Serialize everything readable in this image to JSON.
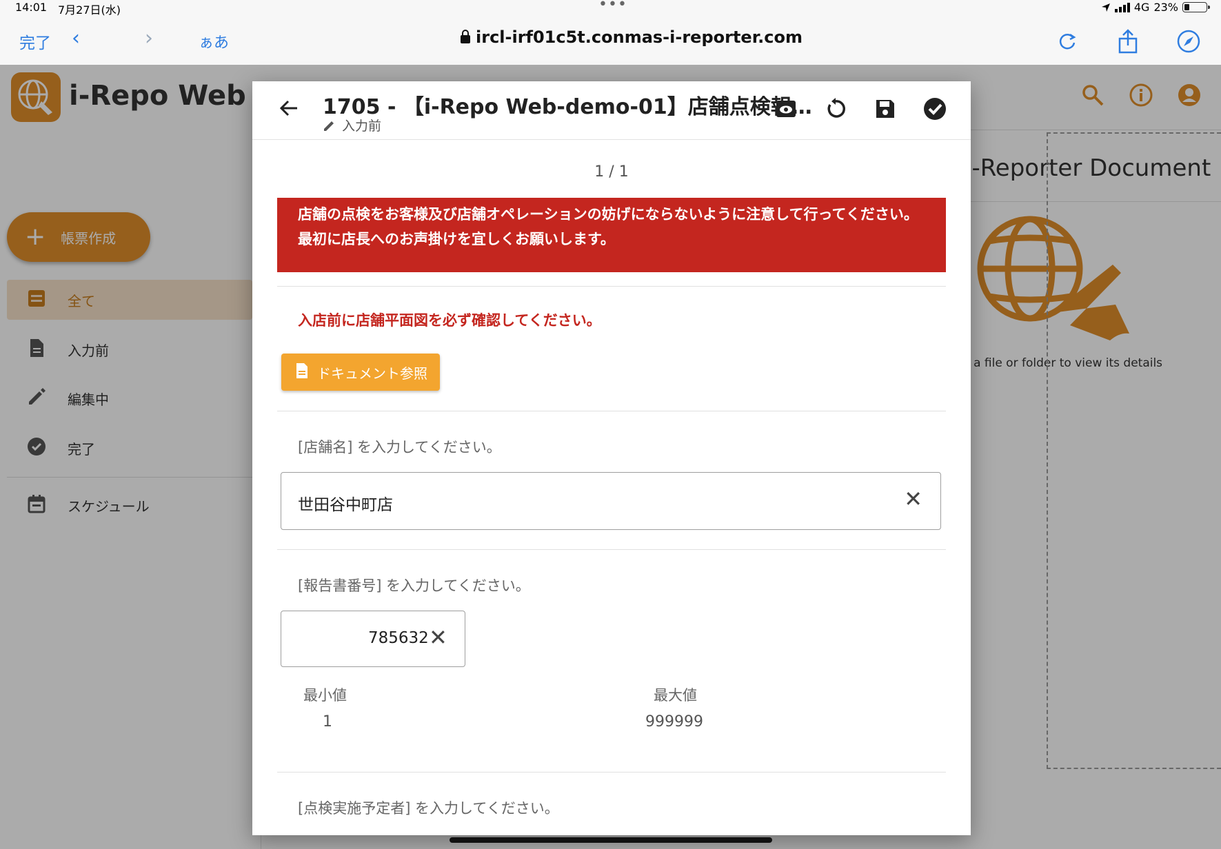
{
  "status_bar": {
    "time": "14:01",
    "date": "7月27日(水)",
    "network": "4G",
    "battery": "23%"
  },
  "browser": {
    "done_label": "完了",
    "text_size_label": "ぁあ",
    "url": "ircl-irf01c5t.conmas-i-reporter.com"
  },
  "app": {
    "brand": "i-Repo Web",
    "create_button": "帳票作成",
    "nav": [
      {
        "label": "全て",
        "icon": "inbox-icon",
        "active": true
      },
      {
        "label": "入力前",
        "icon": "document-icon",
        "active": false
      },
      {
        "label": "編集中",
        "icon": "pencil-icon",
        "active": false
      },
      {
        "label": "完了",
        "icon": "check-circle-icon",
        "active": false
      },
      {
        "label": "スケジュール",
        "icon": "calendar-icon",
        "active": false
      }
    ],
    "detail_title": "i-Reporter Document",
    "detail_hint": "t a file or folder to view its details"
  },
  "modal": {
    "title": "1705 - 【i-Repo Web-demo-01】店舗点検報…",
    "status": "入力前",
    "page_indicator": "1 / 1",
    "banner": "店舗の点検をお客様及び店舗オペレーションの妨げにならないように注意して行ってください。 最初に店長へのお声掛けを宜しくお願いします。",
    "warning": "入店前に店舗平面図を必ず確認してください。",
    "document_button": "ドキュメント参照",
    "store_name_label": "[店舗名] を入力してください。",
    "store_name_value": "世田谷中町店",
    "report_no_label": "[報告書番号] を入力してください。",
    "report_no_value": "785632",
    "min_label": "最小値",
    "min_value": "1",
    "max_label": "最大値",
    "max_value": "999999",
    "inspector_label": "[点検実施予定者] を入力してください。"
  },
  "colors": {
    "accent": "#e08e2a",
    "banner": "#c4261f",
    "doc_button": "#f3a52f",
    "link_blue": "#2f7de0"
  }
}
